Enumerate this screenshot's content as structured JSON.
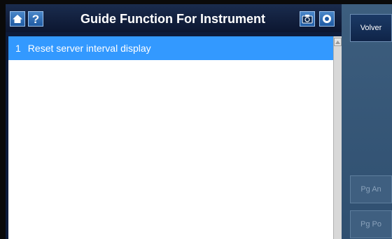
{
  "header": {
    "title": "Guide Function For Instrument",
    "icons": [
      "home-icon",
      "help-icon",
      "camera-icon",
      "record-icon"
    ]
  },
  "list": {
    "items": [
      {
        "number": "1",
        "label": "Reset server interval display"
      }
    ]
  },
  "sidebar": {
    "back_label": "Volver",
    "page_up_label": "Pg An",
    "page_down_label": "Pg Po"
  },
  "colors": {
    "selection": "#3399ff",
    "title_bar": "#0d1b3a",
    "side_panel": "#3d5e7e"
  }
}
